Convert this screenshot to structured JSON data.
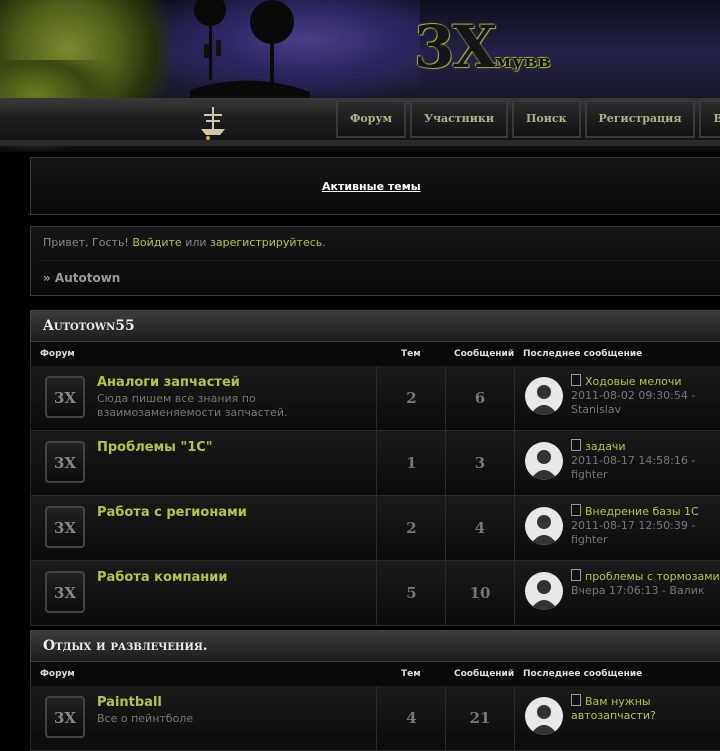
{
  "logo": {
    "main": "3X",
    "sub": "мувв"
  },
  "nav": [
    "Форум",
    "Участники",
    "Поиск",
    "Регистрация",
    "Войти"
  ],
  "active_topics": "Активные темы",
  "welcome": {
    "greeting": "Привет, Гость!",
    "login": "Войдите",
    "or": "или",
    "register": "зарегистрируйтесь",
    "dot": "."
  },
  "breadcrumb": "» Autotown",
  "icon_text": "3X",
  "columns": {
    "forum": "Форум",
    "topics": "Тем",
    "posts": "Сообщений",
    "last": "Последнее сообщение"
  },
  "categories": [
    {
      "title": "Autotown55",
      "forums": [
        {
          "name": "Аналоги запчастей",
          "desc": "Сюда пишем все знания по взаимозаменяемости запчастей.",
          "topics": "2",
          "posts": "6",
          "last_title": "Ходовые мелочи",
          "last_date": "2011-08-02 09:30:54 -",
          "last_user": "Stanislav"
        },
        {
          "name": "Проблемы \"1С\"",
          "desc": "",
          "topics": "1",
          "posts": "3",
          "last_title": "задачи",
          "last_date": "2011-08-17 14:58:16 -",
          "last_user": "fighter"
        },
        {
          "name": "Работа с регионами",
          "desc": "",
          "topics": "2",
          "posts": "4",
          "last_title": "Внедрение базы 1С",
          "last_date": "2011-08-17 12:50:39 -",
          "last_user": "fighter"
        },
        {
          "name": "Работа компании",
          "desc": "",
          "topics": "5",
          "posts": "10",
          "last_title": "проблемы с тормозами",
          "last_date": "Вчера 17:06:13 - Валик",
          "last_user": ""
        }
      ]
    },
    {
      "title": "Отдых и развлечения.",
      "forums": [
        {
          "name": "Paintball",
          "desc": "Все о пейнтболе",
          "topics": "4",
          "posts": "21",
          "last_title": "Вам нужны автозапчасти?",
          "last_date": "",
          "last_user": ""
        }
      ]
    }
  ],
  "colors": {
    "accent": "#b5c63a",
    "text": "#777777"
  }
}
